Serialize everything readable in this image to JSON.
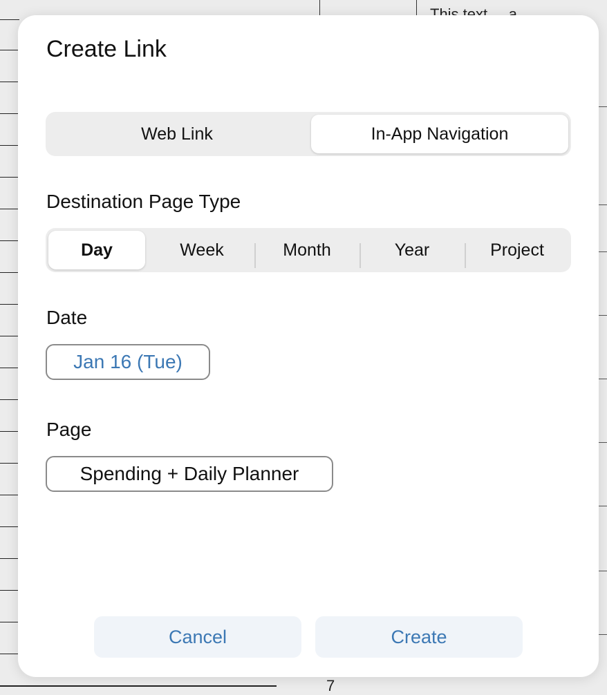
{
  "dialog": {
    "title": "Create Link",
    "link_type_tabs": [
      {
        "label": "Web Link",
        "selected": false
      },
      {
        "label": "In-App Navigation",
        "selected": true
      }
    ],
    "destination_label": "Destination Page Type",
    "page_types": [
      {
        "label": "Day",
        "selected": true
      },
      {
        "label": "Week",
        "selected": false
      },
      {
        "label": "Month",
        "selected": false
      },
      {
        "label": "Year",
        "selected": false
      },
      {
        "label": "Project",
        "selected": false
      }
    ],
    "date_label": "Date",
    "date_value": "Jan 16 (Tue)",
    "page_label": "Page",
    "page_value": "Spending + Daily Planner",
    "cancel_label": "Cancel",
    "create_label": "Create"
  },
  "background": {
    "page_number": "7",
    "top_text_fragment": "This text ... a"
  },
  "colors": {
    "accent": "#3c78b4",
    "button_bg": "#f0f4f9",
    "segment_bg": "#ededed"
  }
}
